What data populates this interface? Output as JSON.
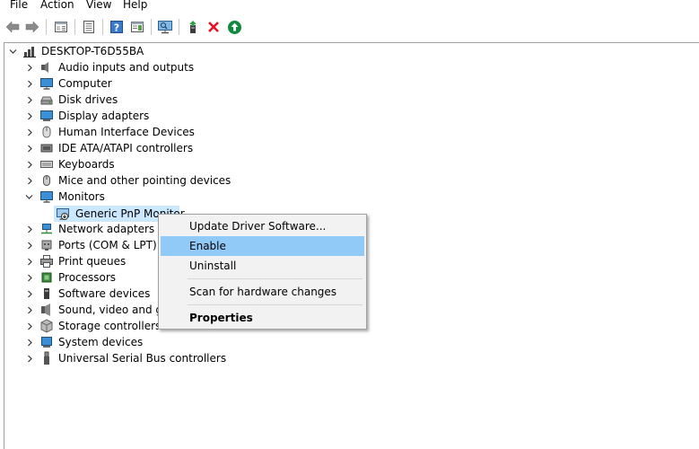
{
  "menu": [
    "File",
    "Action",
    "View",
    "Help"
  ],
  "toolbar": {
    "buttons": [
      "back-arrow-icon",
      "forward-arrow-icon",
      "properties-pane-icon",
      "device-list-icon",
      "help-icon",
      "action-pane-icon",
      "scan-monitor-icon",
      "update-driver-icon",
      "uninstall-x-icon",
      "enable-device-icon"
    ]
  },
  "tree": {
    "root": "DESKTOP-T6D55BA",
    "items": [
      "Audio inputs and outputs",
      "Computer",
      "Disk drives",
      "Display adapters",
      "Human Interface Devices",
      "IDE ATA/ATAPI controllers",
      "Keyboards",
      "Mice and other pointing devices",
      "Monitors",
      "Network adapters",
      "Ports (COM & LPT)",
      "Print queues",
      "Processors",
      "Software devices",
      "Sound, video and gar",
      "Storage controllers",
      "System devices",
      "Universal Serial Bus controllers"
    ],
    "monitor_child": "Generic PnP Monitor"
  },
  "context_menu": {
    "update": "Update Driver Software...",
    "enable": "Enable",
    "uninstall": "Uninstall",
    "scan": "Scan for hardware changes",
    "properties": "Properties"
  },
  "colors": {
    "selection": "#cce8ff",
    "menu_highlight": "#91c9f7",
    "menu_bg": "#f2f2f2",
    "uninstall_red": "#e81123",
    "enable_green": "#10893e"
  }
}
